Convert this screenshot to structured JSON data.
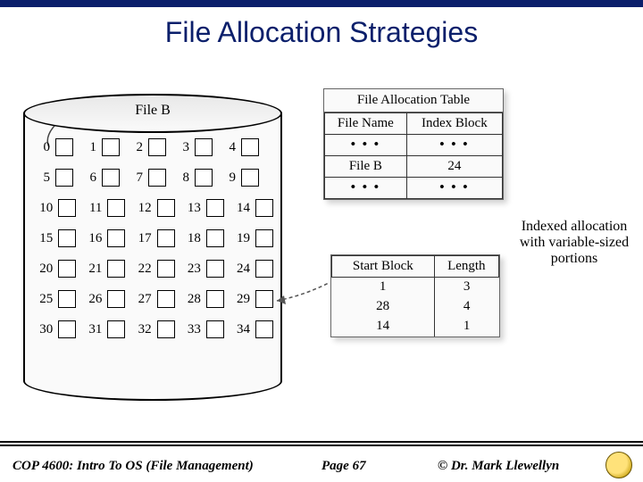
{
  "title": "File Allocation Strategies",
  "disk_label": "File B",
  "blocks": [
    [
      "0",
      "1",
      "2",
      "3",
      "4"
    ],
    [
      "5",
      "6",
      "7",
      "8",
      "9"
    ],
    [
      "10",
      "11",
      "12",
      "13",
      "14"
    ],
    [
      "15",
      "16",
      "17",
      "18",
      "19"
    ],
    [
      "20",
      "21",
      "22",
      "23",
      "24"
    ],
    [
      "25",
      "26",
      "27",
      "28",
      "29"
    ],
    [
      "30",
      "31",
      "32",
      "33",
      "34"
    ]
  ],
  "fat": {
    "title": "File Allocation Table",
    "headers": [
      "File Name",
      "Index Block"
    ],
    "dots": "• • •",
    "row": {
      "name": "File B",
      "index": "24"
    }
  },
  "index_table": {
    "headers": [
      "Start Block",
      "Length"
    ],
    "rows": [
      {
        "start": "1",
        "len": "3"
      },
      {
        "start": "28",
        "len": "4"
      },
      {
        "start": "14",
        "len": "1"
      }
    ]
  },
  "caption": "Indexed allocation with variable-sized portions",
  "footer": {
    "course": "COP 4600: Intro To OS  (File Management)",
    "page": "Page 67",
    "author": "© Dr. Mark Llewellyn"
  }
}
